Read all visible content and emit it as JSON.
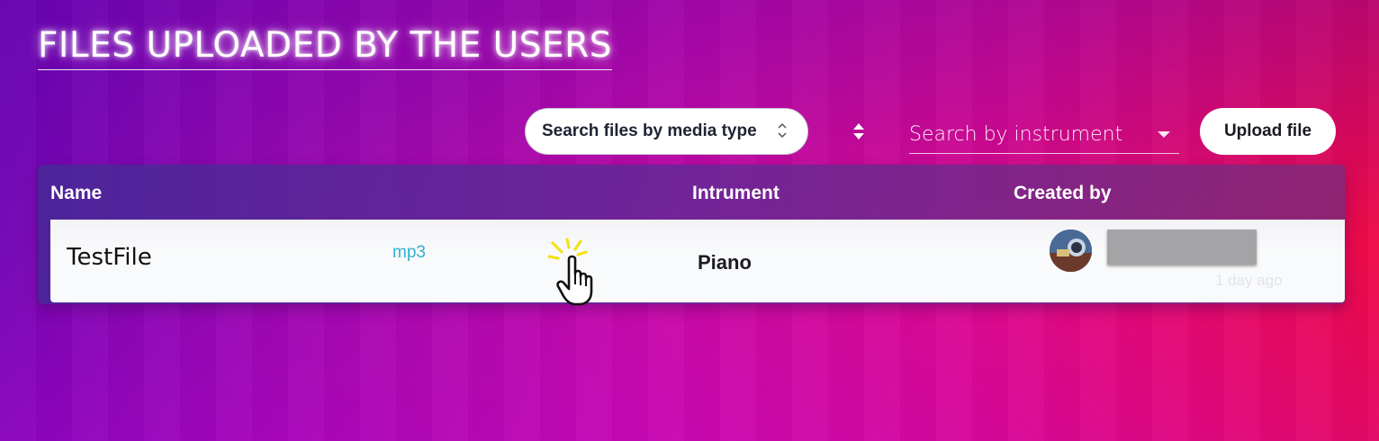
{
  "page": {
    "title": "FILES UPLOADED BY THE USERS"
  },
  "toolbar": {
    "media_type_select": {
      "value": "Search files by media type",
      "icon": "up-down-chevron-icon"
    },
    "sort_icon": "sort-arrows-icon",
    "instrument_search": {
      "placeholder": "Search by instrument",
      "icon": "dropdown-caret-icon"
    },
    "upload_label": "Upload file"
  },
  "table": {
    "columns": [
      "Name",
      "Intrument",
      "Created by"
    ],
    "rows": [
      {
        "name": "TestFile",
        "media_type": "mp3",
        "action_icon": "click-hand-icon",
        "instrument": "Piano",
        "created_by": {
          "avatar": "user-avatar",
          "name_redacted": true,
          "time_ago": "1 day ago"
        }
      }
    ]
  },
  "colors": {
    "accent_link": "#2fb2cf",
    "background_start": "#6c05b4",
    "background_end": "#f00a3f",
    "click_highlight": "#f2e21b"
  }
}
